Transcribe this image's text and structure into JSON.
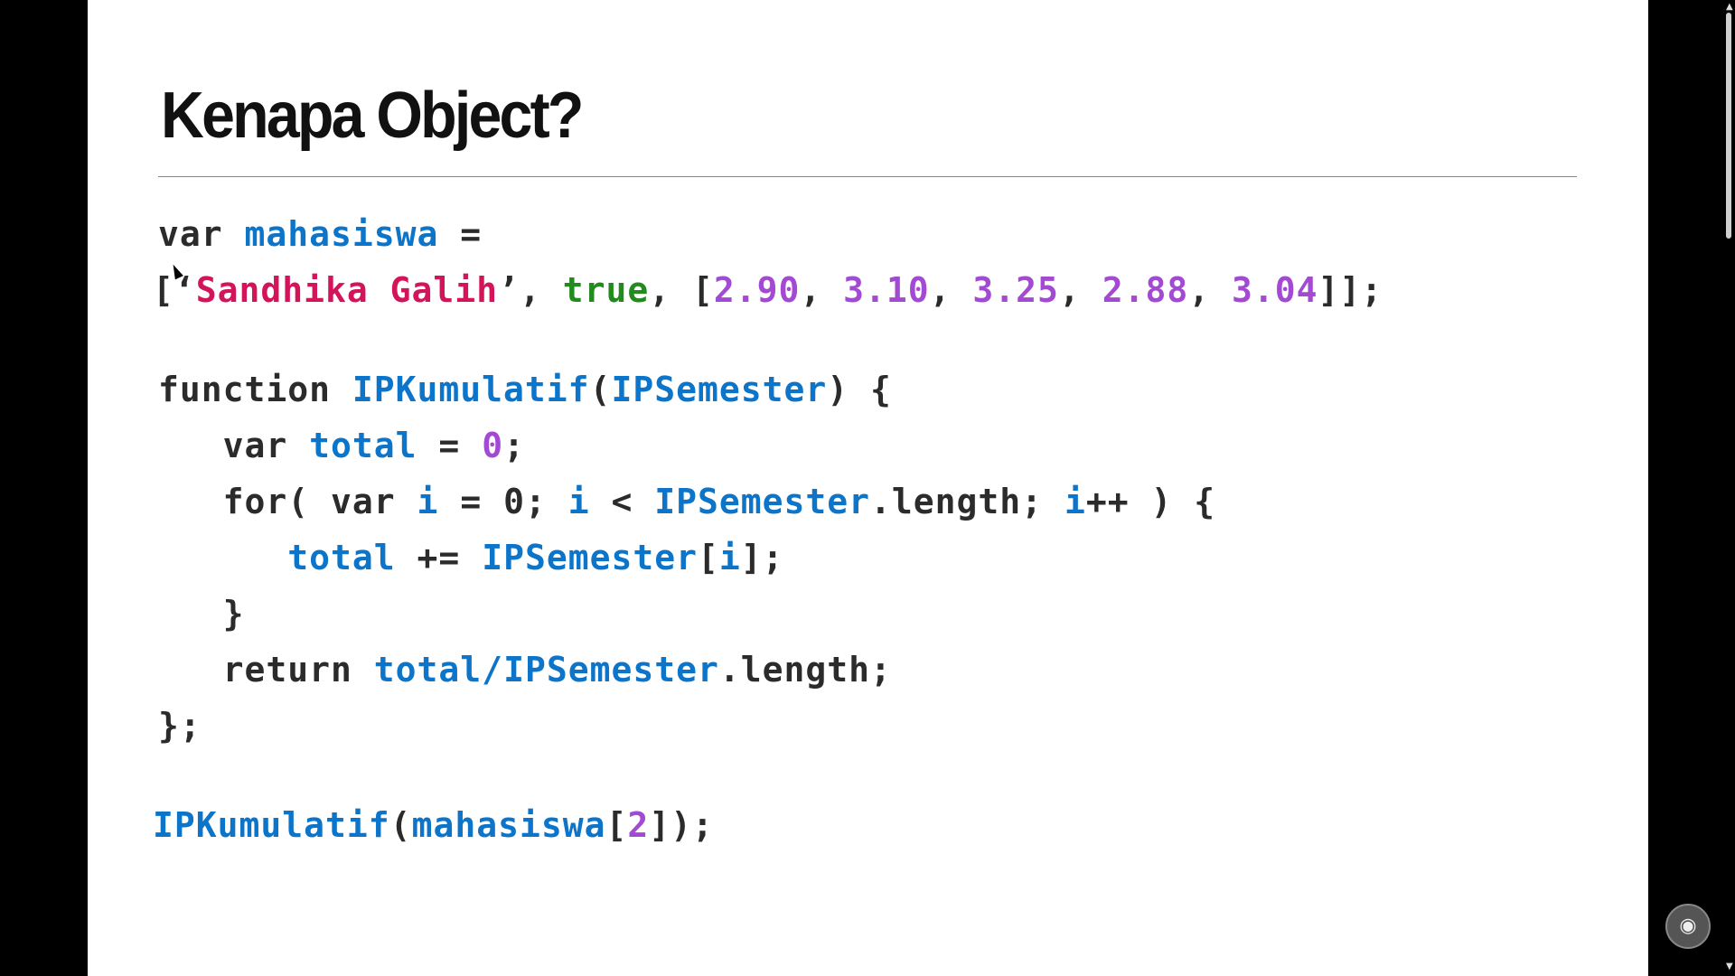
{
  "slide": {
    "title": "Kenapa Object?",
    "code": {
      "l1": {
        "kw": "var ",
        "id": "mahasiswa",
        "rest": " ="
      },
      "l2": {
        "open": "[‘",
        "str": "Sandhika Galih",
        "close_str": "’, ",
        "bool": "true",
        "sep1": ", [",
        "n1": "2.90",
        "c1": ", ",
        "n2": "3.10",
        "c2": ", ",
        "n3": "3.25",
        "c3": ", ",
        "n4": "2.88",
        "c4": ", ",
        "n5": "3.04",
        "end": "]];"
      },
      "l3": {
        "kw": "function ",
        "fn": "IPKumulatif",
        "open": "(",
        "param": "IPSemester",
        "close": ") {"
      },
      "l4": {
        "kw": "   var ",
        "id": "total",
        "eq": " = ",
        "num": "0",
        "end": ";"
      },
      "l5": {
        "a": "   for( var ",
        "i1": "i",
        "b": " = 0; ",
        "i2": "i",
        "c": " < ",
        "arr": "IPSemester",
        "d": ".length; ",
        "i3": "i",
        "e": "++ ) {"
      },
      "l6": {
        "indent": "      ",
        "id": "total",
        "op": " += ",
        "arr": "IPSemester",
        "b": "[",
        "i": "i",
        "end": "];"
      },
      "l7": "   }",
      "l8": {
        "kw": "   return ",
        "id": "total",
        "slash": "/",
        "arr": "IPSemester",
        "end": ".length;"
      },
      "l9": "};",
      "l10": {
        "fn": "IPKumulatif",
        "open": "(",
        "id": "mahasiswa",
        "b": "[",
        "num": "2",
        "end": "]);"
      }
    }
  },
  "colors": {
    "identifier": "#0c74c9",
    "string": "#d4145a",
    "boolean": "#238a1e",
    "number": "#a24bd2",
    "keyword": "#2b2b2b"
  }
}
